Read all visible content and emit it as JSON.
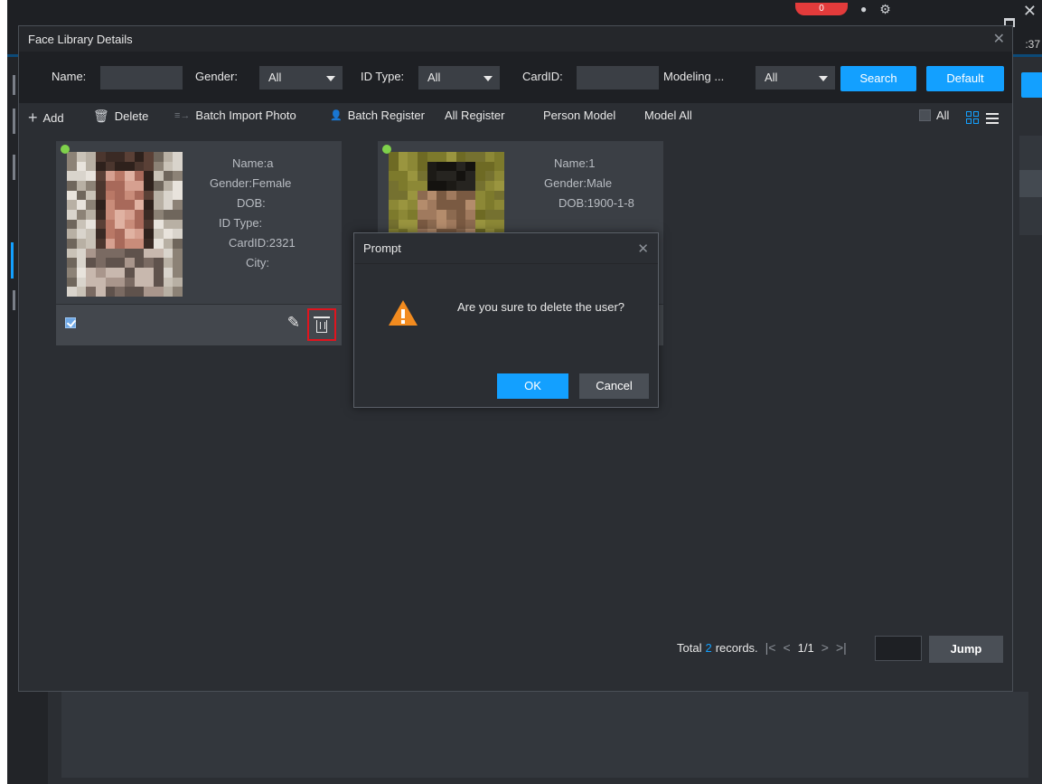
{
  "window": {
    "title": "Face Library Details",
    "close_glyph": "✕",
    "background_time": ":37",
    "background_badge": "0"
  },
  "filters": {
    "name_label": "Name:",
    "name_value": "",
    "gender_label": "Gender:",
    "gender_value": "All",
    "id_type_label": "ID Type:",
    "id_type_value": "All",
    "card_id_label": "CardID:",
    "card_id_value": "",
    "modeling_label": "Modeling ...",
    "modeling_value": "All",
    "search_label": "Search",
    "default_label": "Default"
  },
  "toolbar": {
    "add": "Add",
    "delete": "Delete",
    "batch_import_photo": "Batch Import Photo",
    "batch_register": "Batch Register",
    "all_register": "All Register",
    "person_model": "Person Model",
    "model_all": "Model All",
    "select_all": "All"
  },
  "cards": [
    {
      "name": "Name:a",
      "gender": "Gender:Female",
      "dob": "DOB:",
      "id_type": "ID Type:",
      "card_id": "CardID:2321",
      "city": "City:",
      "status_color": "#7fd14b",
      "checked": true
    },
    {
      "name": "Name:1",
      "gender": "Gender:Male",
      "dob": "DOB:1900-1-8",
      "status_color": "#7fd14b"
    }
  ],
  "pagination": {
    "total_prefix": "Total",
    "total_count": "2",
    "total_suffix": "records.",
    "first_icon": "|<",
    "prev_icon": "<",
    "page": "1/1",
    "next_icon": ">",
    "last_icon": ">|",
    "jump_label": "Jump"
  },
  "prompt": {
    "title": "Prompt",
    "message": "Are you sure to delete the user?",
    "ok_label": "OK",
    "cancel_label": "Cancel",
    "warning_color": "#f28b1f"
  },
  "colors": {
    "accent": "#13a0ff",
    "highlight_border": "#e0141e",
    "panel": "#2b2e33"
  }
}
